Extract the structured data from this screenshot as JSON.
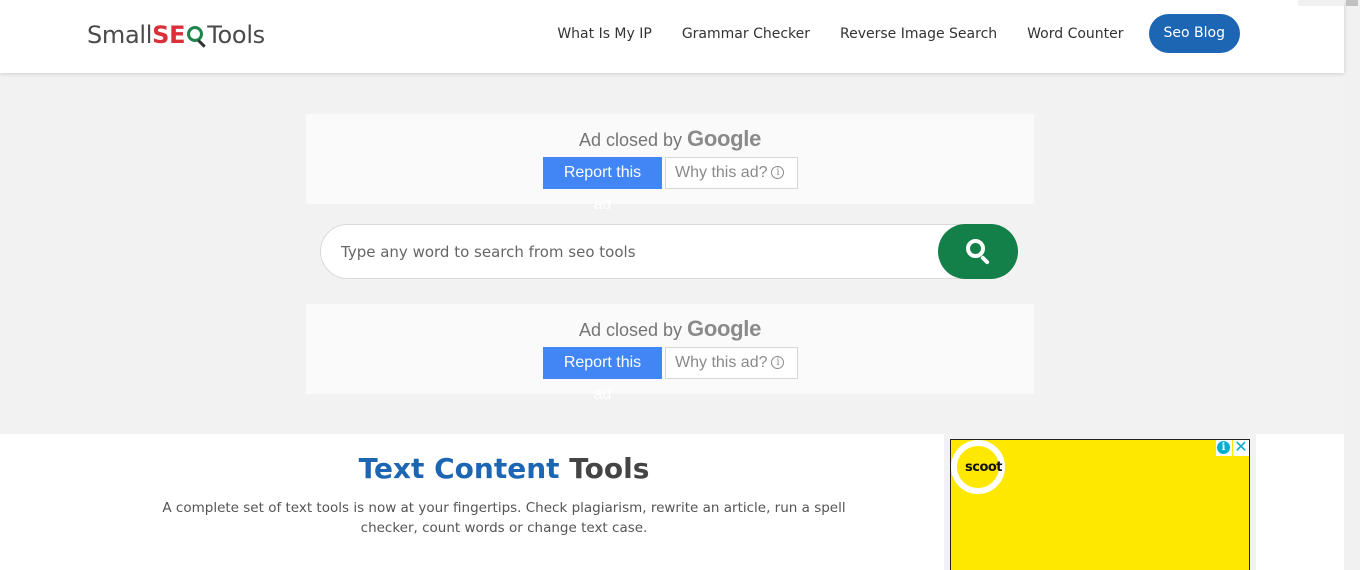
{
  "header": {
    "logo": {
      "part1": "Small",
      "part2": "SE",
      "part3": "Tools"
    },
    "nav": [
      {
        "label": "What Is My IP"
      },
      {
        "label": "Grammar Checker"
      },
      {
        "label": "Reverse Image Search"
      },
      {
        "label": "Word Counter"
      }
    ],
    "cta_label": "Seo Blog"
  },
  "ads": [
    {
      "closed_prefix": "Ad closed by",
      "closed_brand": "Google",
      "report_label": "Report this ad",
      "why_label": "Why this ad?"
    },
    {
      "closed_prefix": "Ad closed by",
      "closed_brand": "Google",
      "report_label": "Report this ad",
      "why_label": "Why this ad?"
    }
  ],
  "search": {
    "placeholder": "Type any word to search from seo tools",
    "value": "",
    "button_icon": "search-icon"
  },
  "section": {
    "title_highlight": "Text Content",
    "title_rest": "Tools",
    "description": "A complete set of text tools is now at your fingertips. Check plagiarism, rewrite an article, run a spell checker, count words or change text case."
  },
  "side_ad": {
    "brand": "scoot",
    "info_icon": "info-icon",
    "close_icon": "close-icon",
    "background": "#ffe800"
  },
  "colors": {
    "primary_blue": "#1d66b3",
    "search_green": "#13804a",
    "logo_red": "#d9303a",
    "report_blue": "#4285f4"
  }
}
